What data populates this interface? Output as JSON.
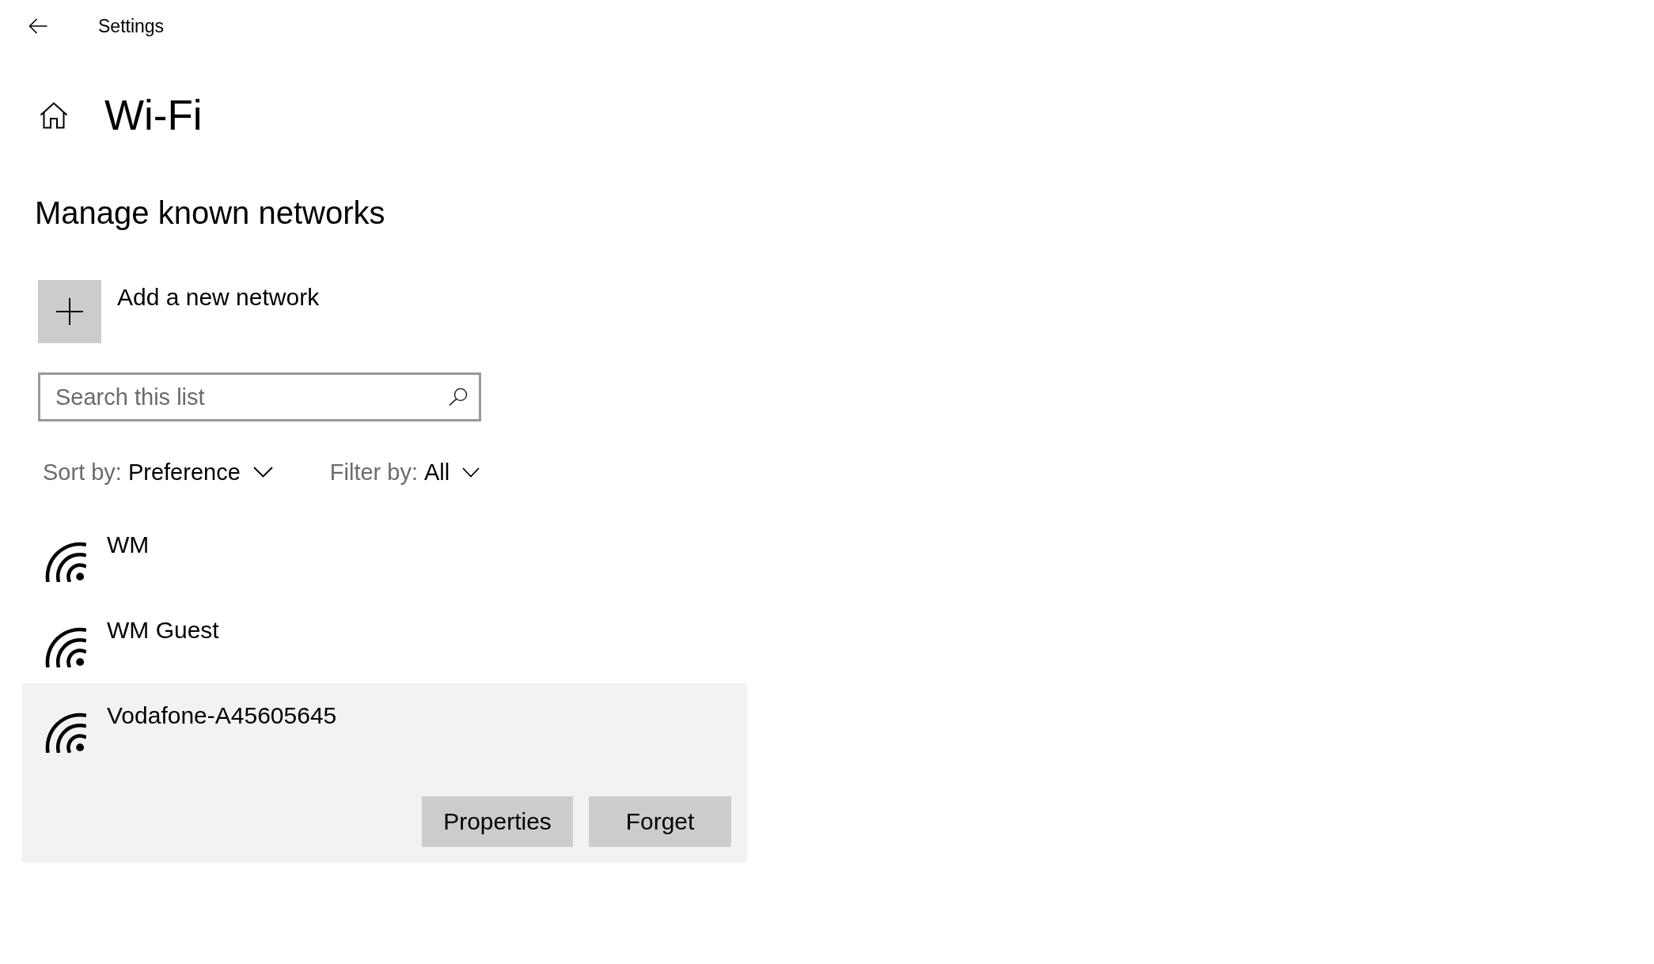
{
  "header": {
    "title": "Settings"
  },
  "page": {
    "title": "Wi-Fi"
  },
  "section": {
    "title": "Manage known networks"
  },
  "add_network": {
    "label": "Add a new network"
  },
  "search": {
    "placeholder": "Search this list"
  },
  "sort": {
    "label": "Sort by:",
    "value": "Preference"
  },
  "filter": {
    "label": "Filter by:",
    "value": "All"
  },
  "networks": [
    {
      "name": "WM",
      "selected": false
    },
    {
      "name": "WM Guest",
      "selected": false
    },
    {
      "name": "Vodafone-A45605645",
      "selected": true
    }
  ],
  "network_actions": [
    "Properties",
    "Forget"
  ]
}
